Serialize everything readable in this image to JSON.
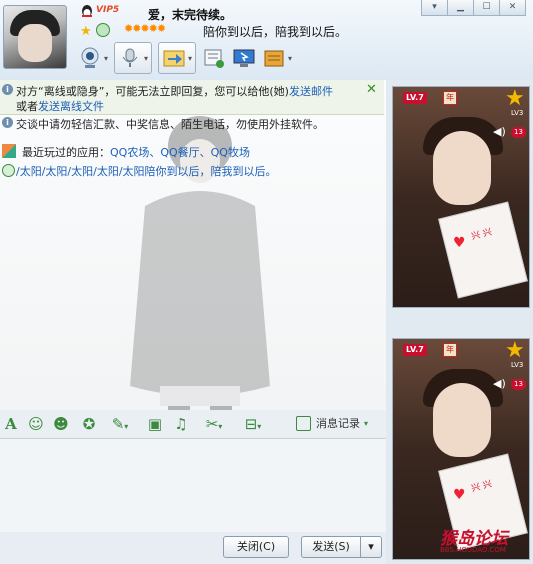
{
  "window": {
    "contact_name": "爱，末完待续。",
    "vip": "VIP5",
    "signature": "陪你到以后，陪我到以后。",
    "controls": [
      "▾",
      "▁",
      "☐",
      "✕"
    ]
  },
  "toolbar": {
    "items": [
      "video-call",
      "voice-call",
      "send-file",
      "create-discussion",
      "remote-assist",
      "app-more"
    ]
  },
  "notice": {
    "line1_a": "对方“离线或隐身”，可能无法立即回复，您可以给他(她)",
    "line1_link": "发送邮件",
    "line2_a": "或者",
    "line2_link": "发送离线文件",
    "close": "✕"
  },
  "chat": {
    "warning": "交谈中请勿轻信汇款、中奖信息、陌生电话，勿使用外挂软件。",
    "apps_label": "最近玩过的应用：",
    "apps_links": "QQ农场、QQ餐厅、QQ牧场",
    "signature_line": "/太阳/太阳/太阳/太阳/太阳陪你到以后，陪我到以后。"
  },
  "format_bar": {
    "font": "A",
    "history_label": "消息记录"
  },
  "buttons": {
    "close_label": "关闭(C)",
    "send_label": "发送(S)",
    "send_arrow": "▾"
  },
  "video_panels": [
    {
      "level": "LV.7",
      "year": "年",
      "count": "13",
      "lv3": "LV3",
      "card_text": "兴 兴"
    },
    {
      "level": "LV.7",
      "year": "年",
      "count": "13",
      "lv3": "LV3",
      "card_text": "兴 兴"
    }
  ],
  "watermark": {
    "text": "猴岛论坛",
    "url": "BBS.HOUDAO.COM"
  },
  "colors": {
    "link": "#1c5fb8",
    "accent_green": "#3c8a3c",
    "badge_red": "#c8102e"
  }
}
